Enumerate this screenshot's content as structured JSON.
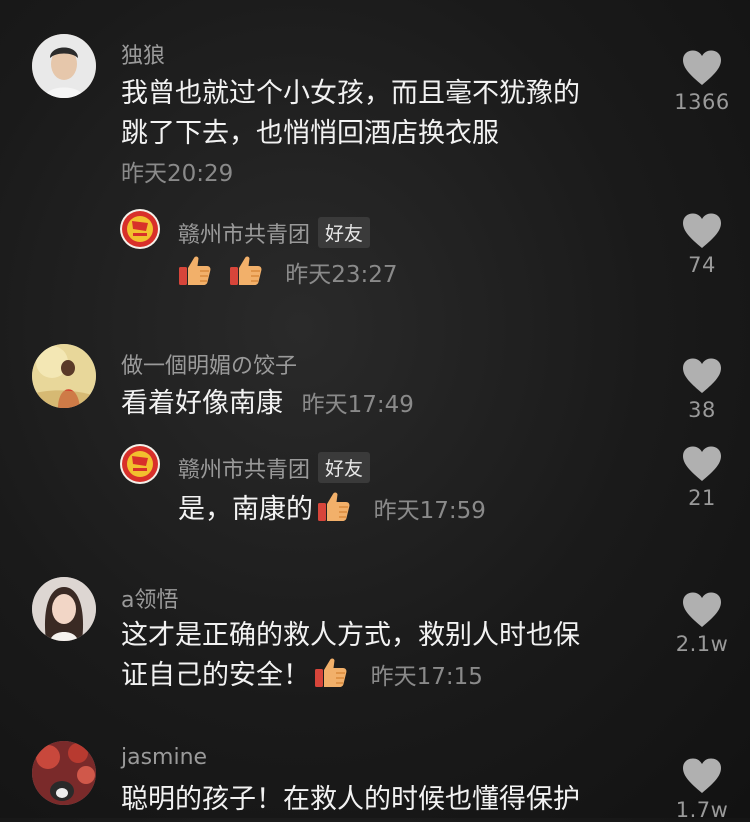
{
  "colors": {
    "background": "#1a1a1a",
    "username": "#9a9a9a",
    "body": "#f2f2f2",
    "timestamp": "#8a8a8a",
    "like_icon": "#b0b0b0",
    "badge_bg": "#3a3a3a"
  },
  "comments": [
    {
      "username": "独狼",
      "text_line1": "我曾也就过个小女孩，而且毫不犹豫的",
      "text_line2": "跳了下去，也悄悄回酒店换衣服",
      "time": "昨天20:29",
      "likes": "1366",
      "reply": {
        "username": "赣州市共青团",
        "badge": "好友",
        "emoji": [
          "thumbs-up",
          "thumbs-up"
        ],
        "time": "昨天23:27",
        "likes": "74"
      }
    },
    {
      "username": "做一個明媚の饺子",
      "text": "看着好像南康",
      "time": "昨天17:49",
      "likes": "38",
      "reply": {
        "username": "赣州市共青团",
        "badge": "好友",
        "text": "是，南康的",
        "emoji": [
          "thumbs-up"
        ],
        "time": "昨天17:59",
        "likes": "21"
      }
    },
    {
      "username": "a领悟",
      "text_line1": "这才是正确的救人方式，救别人时也保",
      "text_line2": "证自己的安全！",
      "emoji": [
        "thumbs-up"
      ],
      "time": "昨天17:15",
      "likes": "2.1w"
    },
    {
      "username": "jasmine",
      "text_line1": "聪明的孩子！在救人的时候也懂得保护",
      "likes": "1.7w"
    }
  ]
}
